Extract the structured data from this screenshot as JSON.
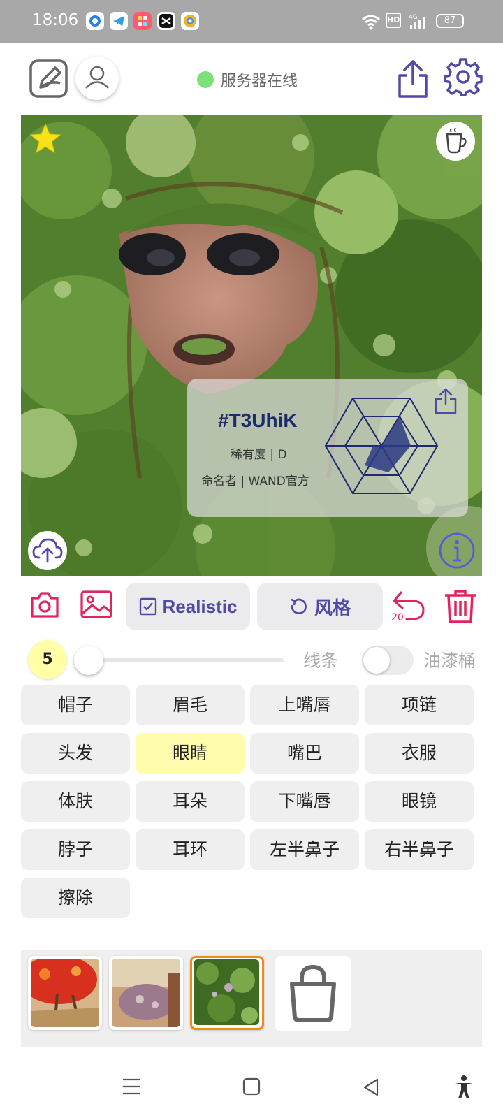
{
  "status_bar": {
    "time": "18:06",
    "battery": "87",
    "network": "4G",
    "hd": "HD",
    "notification_icons": [
      "browser-app-icon",
      "telegram-icon",
      "photo-app-icon",
      "capcut-icon",
      "chrome-like-icon"
    ]
  },
  "header": {
    "server_status": "服务器在线",
    "server_status_color": "#7ee07a",
    "accent": "#4f4aa8"
  },
  "canvas": {
    "card": {
      "id": "#T3UhiK",
      "rarity": "稀有度 | D",
      "namer": "命名者 | WAND官方"
    }
  },
  "actions": {
    "realistic_label": "Realistic",
    "style_label": "风格",
    "undo_count": "20"
  },
  "brush": {
    "size": "5",
    "lines_label": "线条",
    "bucket_label": "油漆桶",
    "bucket_enabled": false
  },
  "parts": [
    {
      "label": "帽子"
    },
    {
      "label": "眉毛"
    },
    {
      "label": "上嘴唇"
    },
    {
      "label": "项链"
    },
    {
      "label": "头发"
    },
    {
      "label": "眼睛",
      "selected": true
    },
    {
      "label": "嘴巴"
    },
    {
      "label": "衣服"
    },
    {
      "label": "体肤"
    },
    {
      "label": "耳朵"
    },
    {
      "label": "下嘴唇"
    },
    {
      "label": "眼镜"
    },
    {
      "label": "脖子"
    },
    {
      "label": "耳环"
    },
    {
      "label": "左半鼻子"
    },
    {
      "label": "右半鼻子"
    },
    {
      "label": "擦除"
    }
  ],
  "gallery": {
    "thumbnails": [
      {
        "name": "red-tree-thumbnail",
        "selected": false
      },
      {
        "name": "textured-face-thumbnail",
        "selected": false
      },
      {
        "name": "green-forest-thumbnail",
        "selected": true
      }
    ]
  }
}
